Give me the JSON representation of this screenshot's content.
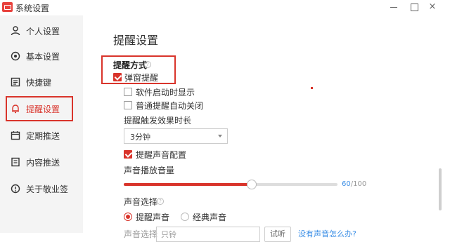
{
  "window": {
    "title": "系统设置",
    "minimize_label": "",
    "maximize_label": "",
    "close_label": "×"
  },
  "sidebar": {
    "items": [
      {
        "label": "个人设置",
        "icon": "user-icon"
      },
      {
        "label": "基本设置",
        "icon": "target-icon"
      },
      {
        "label": "快捷键",
        "icon": "keyboard-icon"
      },
      {
        "label": "提醒设置",
        "icon": "bell-icon",
        "active": true
      },
      {
        "label": "定期推送",
        "icon": "calendar-icon"
      },
      {
        "label": "内容推送",
        "icon": "document-icon"
      },
      {
        "label": "关于敬业签",
        "icon": "info-icon"
      }
    ]
  },
  "main": {
    "page_title": "提醒设置",
    "section_title": "提醒方式",
    "popup_reminder": {
      "label": "弹窗提醒",
      "checked": true
    },
    "show_on_startup": {
      "label": "软件启动时显示",
      "checked": false
    },
    "auto_close": {
      "label": "普通提醒自动关闭",
      "checked": false
    },
    "effect_duration": {
      "label": "提醒触发效果时长",
      "value": "3分钟"
    },
    "sound_config": {
      "label": "提醒声音配置",
      "checked": true
    },
    "volume": {
      "label": "声音播放音量",
      "value": 60,
      "max": 100,
      "value_text": "60",
      "max_text": "/100"
    },
    "sound_choice": {
      "label": "声音选择",
      "options": [
        "提醒声音",
        "经典声音"
      ],
      "selected": 0
    },
    "partial_row": {
      "label": "声音选择",
      "value": "只铃",
      "button": "试听",
      "link": "没有声音怎么办?"
    }
  },
  "colors": {
    "accent": "#d9342b",
    "sidebar_bg": "#f4f4f4",
    "active_text": "#d9342b"
  }
}
